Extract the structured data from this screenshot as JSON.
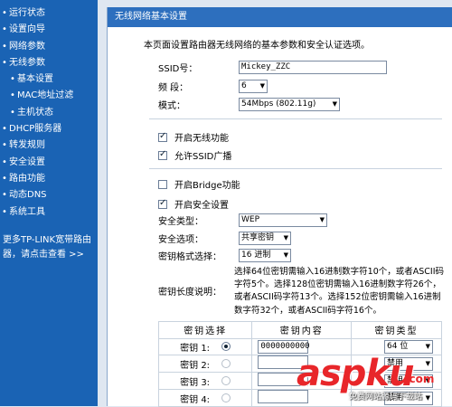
{
  "sidebar": {
    "items": [
      {
        "label": "运行状态",
        "sub": false
      },
      {
        "label": "设置向导",
        "sub": false
      },
      {
        "label": "网络参数",
        "sub": false
      },
      {
        "label": "无线参数",
        "sub": false
      },
      {
        "label": "基本设置",
        "sub": true
      },
      {
        "label": "MAC地址过滤",
        "sub": true
      },
      {
        "label": "主机状态",
        "sub": true
      },
      {
        "label": "DHCP服务器",
        "sub": false
      },
      {
        "label": "转发规则",
        "sub": false
      },
      {
        "label": "安全设置",
        "sub": false
      },
      {
        "label": "路由功能",
        "sub": false
      },
      {
        "label": "动态DNS",
        "sub": false
      },
      {
        "label": "系统工具",
        "sub": false
      }
    ],
    "promo_line1": "更多TP-LINK宽带路由",
    "promo_line2": "器，请点击查看 >>"
  },
  "page": {
    "title": "无线网络基本设置",
    "description": "本页面设置路由器无线网络的基本参数和安全认证选项。",
    "ssid_label": "SSID号：",
    "ssid_value": "Mickey_ZZC",
    "channel_label": "频 段：",
    "channel_value": "6",
    "mode_label": "模式：",
    "mode_value": "54Mbps (802.11g)",
    "enable_wireless": "开启无线功能",
    "allow_ssid_broadcast": "允许SSID广播",
    "enable_bridge": "开启Bridge功能",
    "enable_security": "开启安全设置",
    "security_type_label": "安全类型：",
    "security_type_value": "WEP",
    "security_option_label": "安全选项：",
    "security_option_value": "共享密钥",
    "key_format_label": "密钥格式选择：",
    "key_format_value": "16 进制",
    "key_length_label": "密钥长度说明：",
    "key_length_hint": "选择64位密钥需输入16进制数字符10个，或者ASCII码字符5个。选择128位密钥需输入16进制数字符26个，或者ASCII码字符13个。选择152位密钥需输入16进制数字符32个，或者ASCII码字符16个。"
  },
  "key_table": {
    "headers": [
      "密钥选择",
      "密钥内容",
      "密钥类型"
    ],
    "rows": [
      {
        "label": "密钥 1:",
        "selected": true,
        "value": "0000000000",
        "type": "64 位"
      },
      {
        "label": "密钥 2:",
        "selected": false,
        "value": "",
        "type": "禁用"
      },
      {
        "label": "密钥 3:",
        "selected": false,
        "value": "",
        "type": "禁用"
      },
      {
        "label": "密钥 4:",
        "selected": false,
        "value": "",
        "type": "禁用"
      }
    ]
  },
  "watermark": {
    "big": "aspku",
    "dotcom": ".com",
    "small": "免费网站源码下载站"
  }
}
